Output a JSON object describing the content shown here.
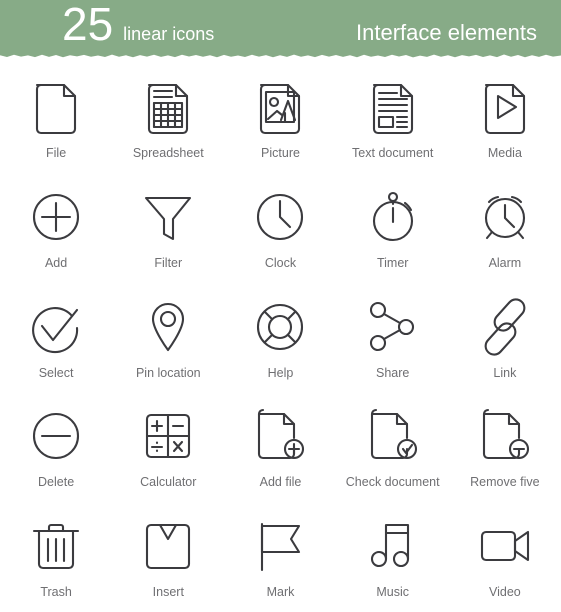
{
  "header": {
    "count": "25",
    "subtitle": "linear icons",
    "title": "Interface elements",
    "bg_color": "#87ab87",
    "text_color": "#ffffff"
  },
  "style": {
    "icon_stroke_color": "#3b3b3f",
    "label_color": "#6f6f72",
    "page_background": "#ffffff"
  },
  "grid": {
    "columns": 5,
    "rows": 5,
    "total_icons": 25
  },
  "icons": [
    {
      "label": "File",
      "icon": "file-icon"
    },
    {
      "label": "Spreadsheet",
      "icon": "spreadsheet-icon"
    },
    {
      "label": "Picture",
      "icon": "picture-icon"
    },
    {
      "label": "Text document",
      "icon": "text-document-icon"
    },
    {
      "label": "Media",
      "icon": "media-icon"
    },
    {
      "label": "Add",
      "icon": "add-icon"
    },
    {
      "label": "Filter",
      "icon": "filter-icon"
    },
    {
      "label": "Clock",
      "icon": "clock-icon"
    },
    {
      "label": "Timer",
      "icon": "timer-icon"
    },
    {
      "label": "Alarm",
      "icon": "alarm-icon"
    },
    {
      "label": "Select",
      "icon": "select-icon"
    },
    {
      "label": "Pin location",
      "icon": "pin-location-icon"
    },
    {
      "label": "Help",
      "icon": "help-icon"
    },
    {
      "label": "Share",
      "icon": "share-icon"
    },
    {
      "label": "Link",
      "icon": "link-icon"
    },
    {
      "label": "Delete",
      "icon": "delete-icon"
    },
    {
      "label": "Calculator",
      "icon": "calculator-icon"
    },
    {
      "label": "Add file",
      "icon": "add-file-icon"
    },
    {
      "label": "Check document",
      "icon": "check-document-icon"
    },
    {
      "label": "Remove five",
      "icon": "remove-file-icon"
    },
    {
      "label": "Trash",
      "icon": "trash-icon"
    },
    {
      "label": "Insert",
      "icon": "insert-icon"
    },
    {
      "label": "Mark",
      "icon": "mark-icon"
    },
    {
      "label": "Music",
      "icon": "music-icon"
    },
    {
      "label": "Video",
      "icon": "video-icon"
    }
  ]
}
